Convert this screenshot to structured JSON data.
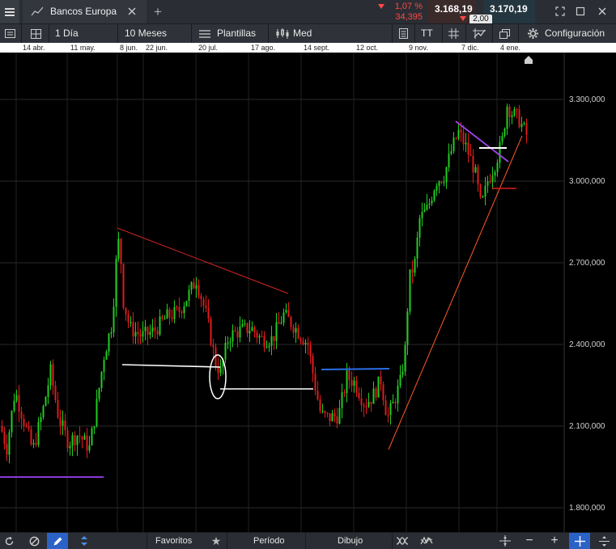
{
  "app": {
    "instrument": "Bancos Europa"
  },
  "quote": {
    "change_pct": "1,07 %",
    "change_abs": "34,395",
    "bid": "3.168,19",
    "ask": "3.170,19",
    "spread": "2,00"
  },
  "toolbar": {
    "interval": "1 Día",
    "range": "10 Meses",
    "templates": "Plantillas",
    "chart_type": "Med",
    "text_tool": "TT",
    "settings": "Configuración"
  },
  "date_axis": [
    "14 abr.",
    "11 may.",
    "8 jun.",
    "22 jun.",
    "20 jul.",
    "17 ago.",
    "14 sept.",
    "12 oct.",
    "9 nov.",
    "7 dic.",
    "4 ene."
  ],
  "y_axis": [
    "3.300,000",
    "3.000,000",
    "2.700,000",
    "2.400,000",
    "2.100,000",
    "1.800,000"
  ],
  "bottom": {
    "favorites": "Favoritos",
    "period": "Período",
    "drawing": "Dibujo"
  },
  "colors": {
    "up": "#22cc22",
    "down": "#e01b1b",
    "bid_bg": "#3a2a2a",
    "ask_bg": "#24363f",
    "negative": "#ff4747"
  },
  "chart_data": {
    "type": "candlestick",
    "ylim": [
      1700,
      3450
    ],
    "y_ticks": [
      1800,
      2100,
      2400,
      2700,
      3000,
      3300
    ],
    "x_labels": [
      "14 abr.",
      "11 may.",
      "8 jun.",
      "22 jun.",
      "20 jul.",
      "17 ago.",
      "14 sept.",
      "12 oct.",
      "9 nov.",
      "7 dic.",
      "4 ene."
    ],
    "grid": true
  }
}
